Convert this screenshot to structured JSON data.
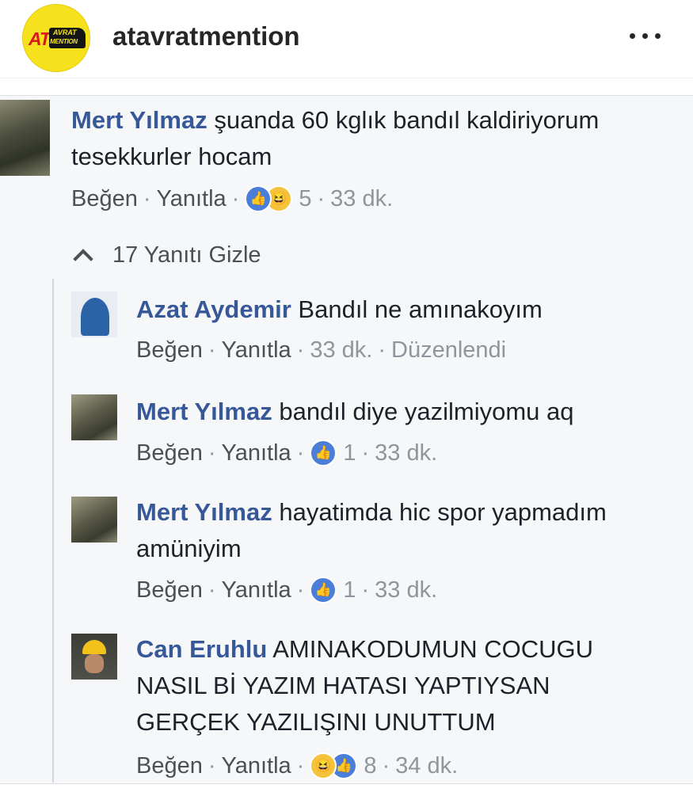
{
  "header": {
    "username": "atavratmention",
    "more_icon": "more-horizontal-icon",
    "logo": {
      "main": "AT",
      "top": "AVRAT",
      "bottom": "MENTION"
    }
  },
  "comment": {
    "author": "Mert Yılmaz",
    "text_line1": " şuanda 60 kglık bandıl kaldiriyorum",
    "text_line2": "tesekkurler hocam",
    "like_label": "Beğen",
    "reply_label": "Yanıtla",
    "reactions": [
      "like",
      "haha"
    ],
    "reaction_count": "5",
    "time": "33 dk."
  },
  "replies_toggle": "17 Yanıtı Gizle",
  "replies": [
    {
      "author": "Azat Aydemir",
      "text_line1": " Bandıl ne amınakoyım",
      "like_label": "Beğen",
      "reply_label": "Yanıtla",
      "time": "33 dk.",
      "edited": "Düzenlendi"
    },
    {
      "author": "Mert Yılmaz",
      "text_line1": " bandıl diye yazilmiyomu aq",
      "like_label": "Beğen",
      "reply_label": "Yanıtla",
      "reactions": [
        "like"
      ],
      "reaction_count": "1",
      "time": "33 dk."
    },
    {
      "author": "Mert Yılmaz",
      "text_line1": " hayatimda hic spor yapmadım",
      "text_line2": "amüniyim",
      "like_label": "Beğen",
      "reply_label": "Yanıtla",
      "reactions": [
        "like"
      ],
      "reaction_count": "1",
      "time": "33 dk."
    },
    {
      "author": "Can Eruhlu",
      "text_line1": " AMINAKODUMUN COCUGU",
      "text_line2": "NASIL Bİ YAZIM HATASI YAPTIYSAN",
      "text_line3": "GERÇEK YAZILIŞINI UNUTTUM",
      "like_label": "Beğen",
      "reply_label": "Yanıtla",
      "reactions": [
        "haha",
        "like"
      ],
      "reaction_count": "8",
      "time": "34 dk."
    }
  ],
  "colors": {
    "name_blue": "#365899",
    "meta_gray": "#90949c",
    "like_blue": "#4a7ed8",
    "logo_yellow": "#f6e11d"
  }
}
